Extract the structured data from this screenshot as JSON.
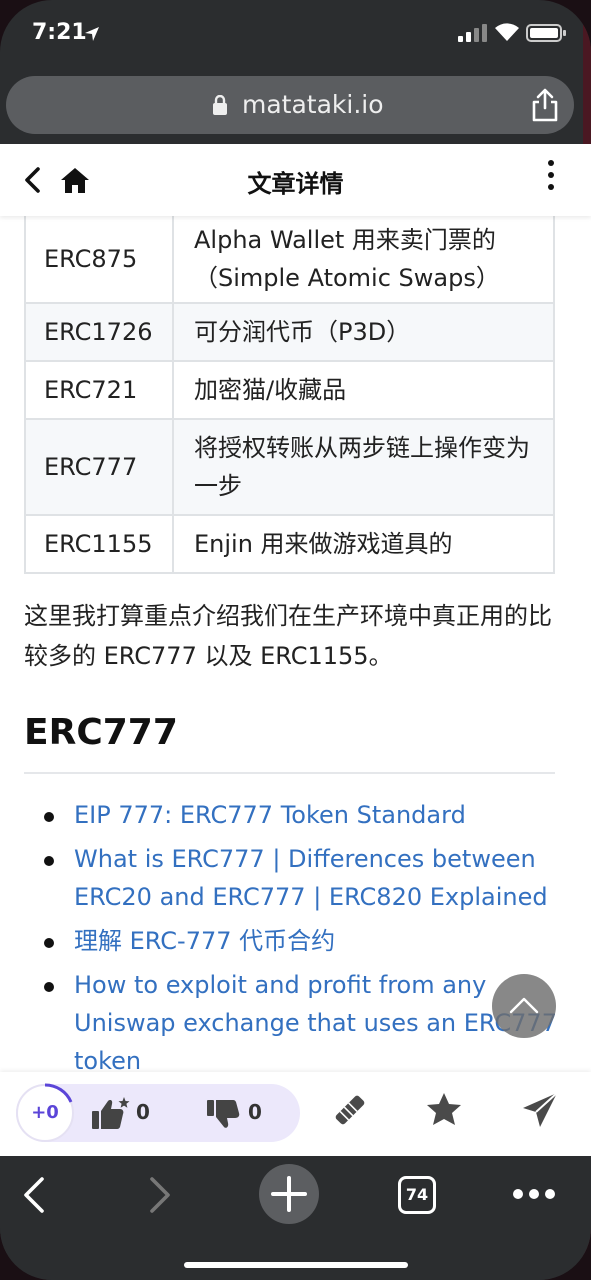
{
  "status": {
    "time": "7:21"
  },
  "browser": {
    "domain": "matataki.io",
    "tab_count": "74"
  },
  "header": {
    "title": "文章详情"
  },
  "table": {
    "rows": [
      {
        "code": "ERC875",
        "desc": "Alpha Wallet 用来卖门票的（Simple Atomic Swaps）"
      },
      {
        "code": "ERC1726",
        "desc": "可分润代币（P3D）"
      },
      {
        "code": "ERC721",
        "desc": "加密猫/收藏品"
      },
      {
        "code": "ERC777",
        "desc": "将授权转账从两步链上操作变为一步"
      },
      {
        "code": "ERC1155",
        "desc": "Enjin 用来做游戏道具的"
      }
    ]
  },
  "article": {
    "paragraph": "这里我打算重点介绍我们在生产环境中真正用的比较多的 ERC777 以及 ERC1155。",
    "heading": "ERC777",
    "links": [
      "EIP 777: ERC777 Token Standard",
      "What is ERC777 | Differences between ERC20 and ERC777 | ERC820 Explained",
      "理解 ERC-777 代币合约",
      "How to exploit and profit from any Uniswap exchange that uses an ERC777 token"
    ]
  },
  "actions": {
    "score": "+0",
    "likes": "0",
    "dislikes": "0"
  },
  "colors": {
    "accent": "#5b45d8",
    "link": "#3370c0",
    "browser_chrome": "#2b2d2f"
  }
}
